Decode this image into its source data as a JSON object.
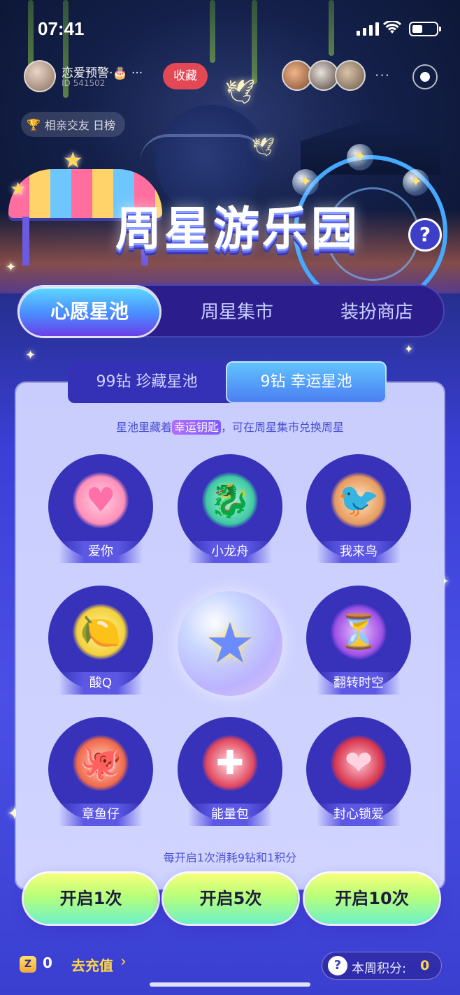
{
  "status_bar": {
    "time": "07:41"
  },
  "room": {
    "name": "恋爱预警·🎂 ···",
    "id": "ID 541502",
    "favorite_label": "收藏",
    "rank_label": "相亲交友 日榜"
  },
  "event": {
    "title": "周星游乐园",
    "help_icon": "?"
  },
  "main_tabs": [
    {
      "label": "心愿星池",
      "active": true
    },
    {
      "label": "周星集市",
      "active": false
    },
    {
      "label": "装扮商店",
      "active": false
    }
  ],
  "pool_tabs": [
    {
      "label": "99钻 珍藏星池",
      "active": false
    },
    {
      "label": "9钻 幸运星池",
      "active": true
    }
  ],
  "hint": {
    "before": "星池里藏着",
    "highlight": "幸运钥匙",
    "after": "，可在周星集市兑换周星"
  },
  "items": [
    {
      "label": "爱你",
      "icon": "heart-hand-icon"
    },
    {
      "label": "小龙舟",
      "icon": "dragon-boat-icon"
    },
    {
      "label": "我来鸟",
      "icon": "bird-icon"
    },
    {
      "label": "酸Q",
      "icon": "lemon-face-icon"
    },
    {
      "label": "翻转时空",
      "icon": "hourglass-icon"
    },
    {
      "label": "章鱼仔",
      "icon": "octopus-icon"
    },
    {
      "label": "能量包",
      "icon": "energy-pack-icon"
    },
    {
      "label": "封心锁爱",
      "icon": "locked-heart-icon"
    }
  ],
  "cost_text": "每开启1次消耗9钻和1积分",
  "buttons": {
    "open1": "开启1次",
    "open5": "开启5次",
    "open10": "开启10次"
  },
  "bottom": {
    "diamond_count": "0",
    "recharge_label": "去充值",
    "points_label": "本周积分:",
    "points_value": "0"
  },
  "colors": {
    "accent": "#3732b9",
    "button_gradient_top": "#f6ff7a",
    "button_gradient_bottom": "#6ef0c8",
    "favorite": "#e34855"
  }
}
